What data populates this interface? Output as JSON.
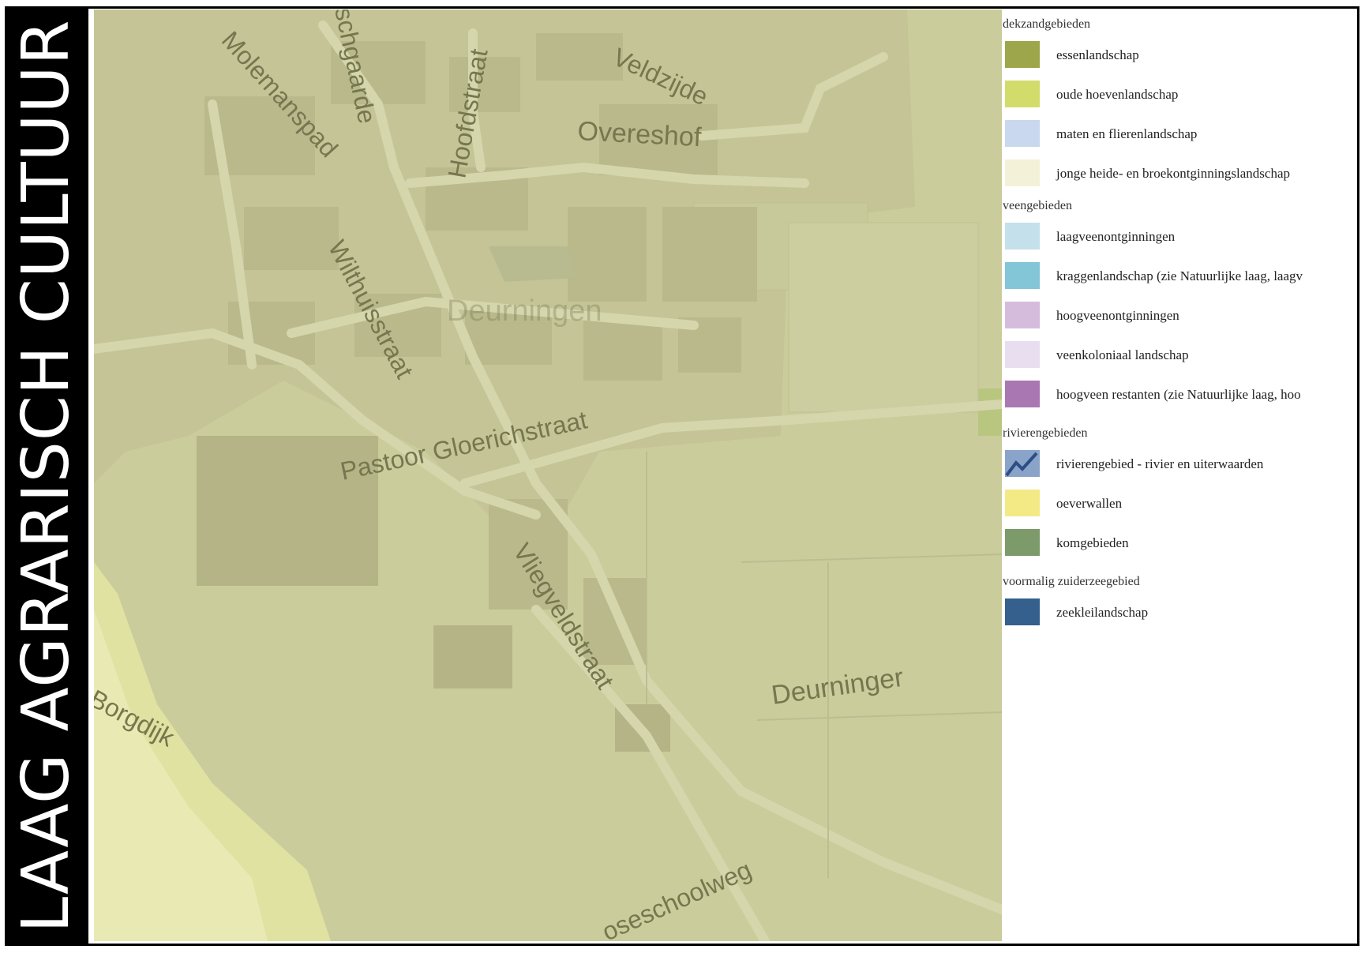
{
  "title": "LAAG AGRARISCH CULTUUR",
  "map": {
    "labels": {
      "molemanspad": "Molemanspad",
      "schgaarde": "schgaarde",
      "hoofdstraat": "Hoofdstraat",
      "veldzijde": "Veldzijde",
      "overeshof": "Overeshof",
      "wilthuisstraat": "Wilthuisstraat",
      "deurningen": "Deurningen",
      "pastoor": "Pastoor Gloerichstraat",
      "vliegveldstraat": "Vliegveldstraat",
      "deurninger": "Deurninger",
      "borgdijk": "Borgdijk",
      "schoolweg": "oseschoolweg"
    }
  },
  "legend": {
    "groups": [
      {
        "name": "dekzandgebieden",
        "items": [
          {
            "label": "essenlandschap",
            "color": "#9ea64b"
          },
          {
            "label": "oude hoevenlandschap",
            "color": "#d2dc6b"
          },
          {
            "label": "maten en flierenlandschap",
            "color": "#c9d8ee"
          },
          {
            "label": "jonge heide- en broekontginningslandschap",
            "color": "#f3f2d9"
          }
        ]
      },
      {
        "name": "veengebieden",
        "items": [
          {
            "label": "laagveenontginningen",
            "color": "#c4e0ea"
          },
          {
            "label": "kraggenlandschap (zie Natuurlijke laag, laagv",
            "color": "#82c6d8"
          },
          {
            "label": "hoogveenontginningen",
            "color": "#d5bcdd"
          },
          {
            "label": "veenkoloniaal landschap",
            "color": "#e9def0"
          },
          {
            "label": "hoogveen restanten (zie Natuurlijke laag, hoo",
            "color": "#a978b2"
          }
        ]
      },
      {
        "name": "rivierengebieden",
        "items": [
          {
            "label": "rivierengebied - rivier en uiterwaarden",
            "color": "#8aa3c8",
            "line": "#2b4e86"
          },
          {
            "label": "oeverwallen",
            "color": "#f3ea86"
          },
          {
            "label": "komgebieden",
            "color": "#7c9a6a"
          }
        ]
      },
      {
        "name": "voormalig zuiderzeegebied",
        "items": [
          {
            "label": "zeekleilandschap",
            "color": "#355f8c"
          }
        ]
      }
    ]
  }
}
